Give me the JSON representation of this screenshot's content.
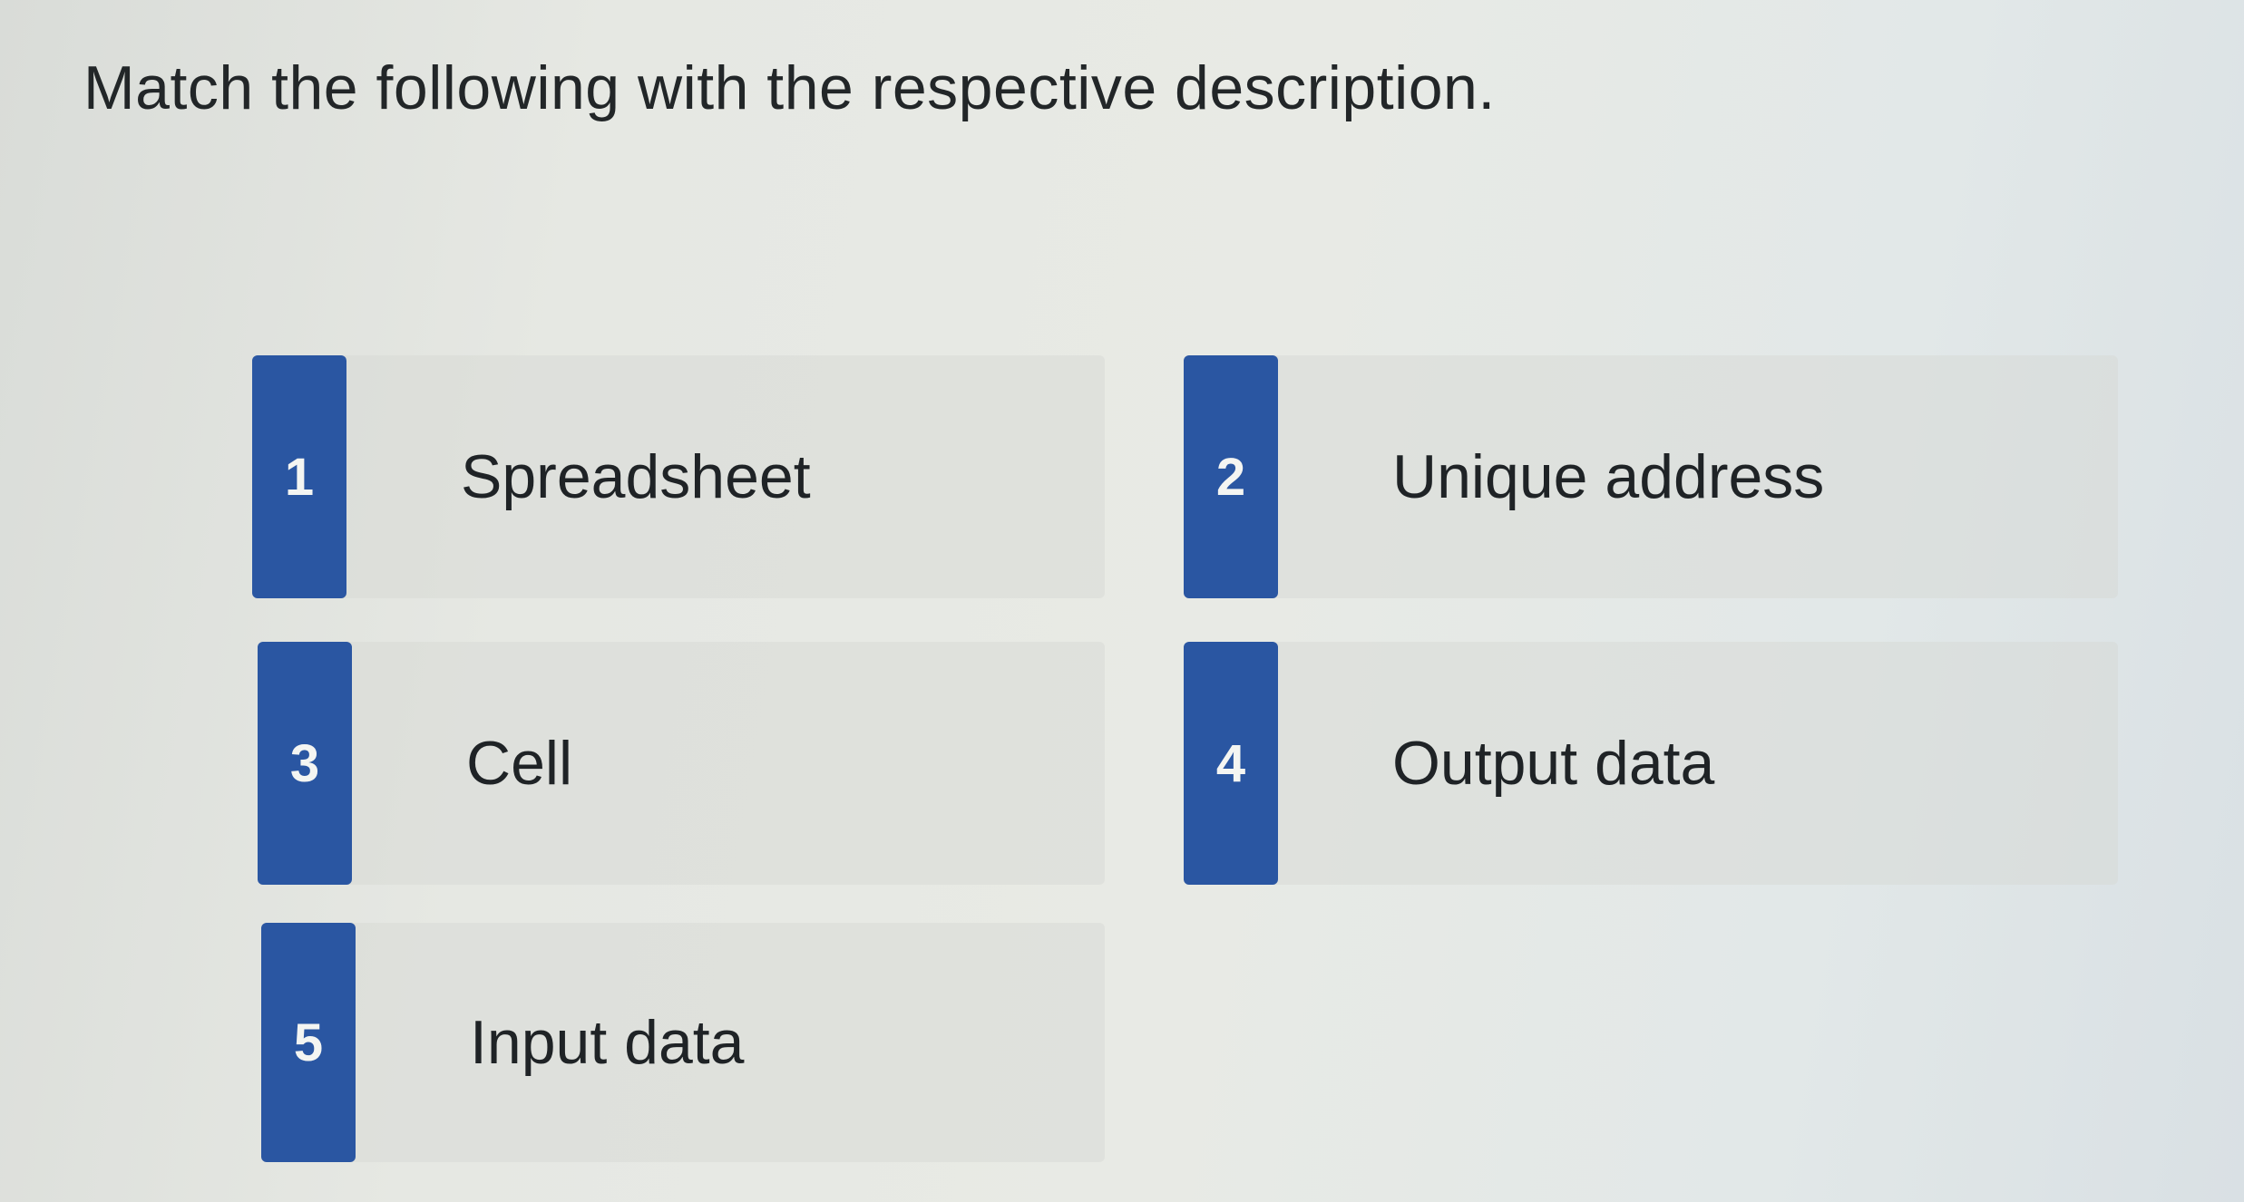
{
  "question": {
    "prompt": "Match the following with the respective description."
  },
  "items": [
    {
      "number": "1",
      "label": "Spreadsheet"
    },
    {
      "number": "2",
      "label": "Unique address"
    },
    {
      "number": "3",
      "label": "Cell"
    },
    {
      "number": "4",
      "label": "Output data"
    },
    {
      "number": "5",
      "label": "Input data"
    }
  ],
  "colors": {
    "badge": "#2a56a2",
    "text": "#1f2326",
    "background": "#e6e8e3"
  }
}
